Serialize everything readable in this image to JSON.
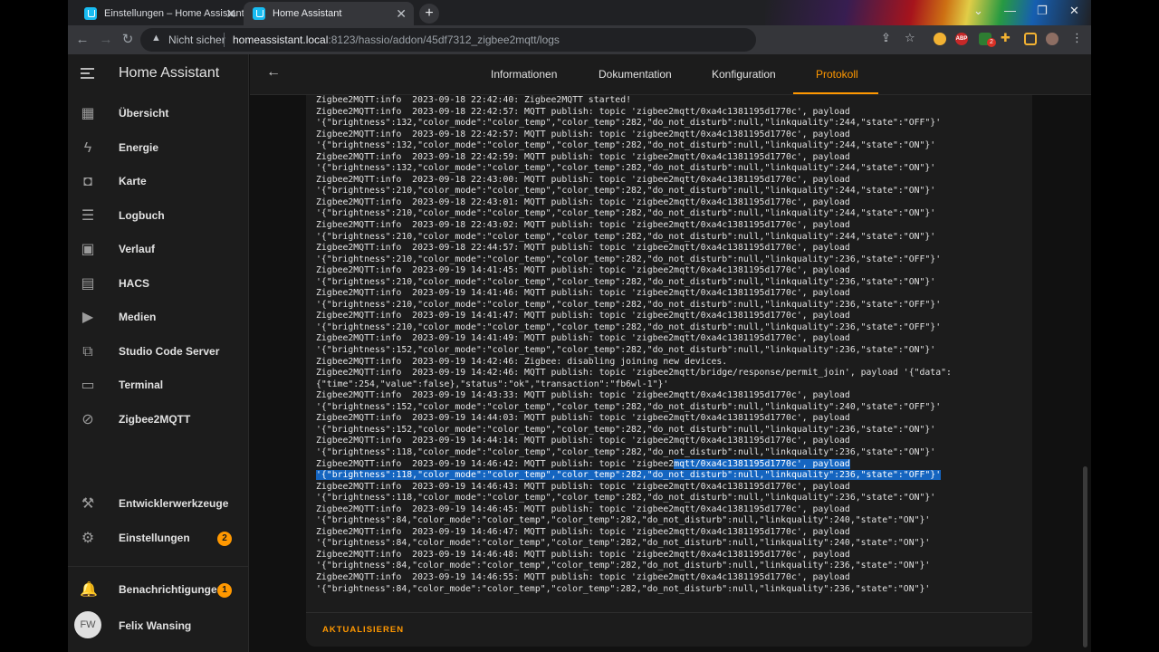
{
  "browser": {
    "tabs": [
      {
        "title": "Einstellungen – Home Assistant",
        "close": "✕"
      },
      {
        "title": "Home Assistant",
        "close": "✕"
      }
    ],
    "new_tab": "+",
    "window_controls": {
      "chevron": "⌄",
      "minimize": "—",
      "restore": "❐",
      "close": "✕"
    },
    "address": {
      "security_label": "Nicht sicher",
      "host": "homeassistant.local",
      "path": ":8123/hassio/addon/45df7312_zigbee2mqtt/logs"
    },
    "extension_badge": "2",
    "abp_label": "ABP"
  },
  "sidebar": {
    "title": "Home Assistant",
    "items": [
      {
        "label": "Übersicht",
        "icon": "▦"
      },
      {
        "label": "Energie",
        "icon": "ϟ"
      },
      {
        "label": "Karte",
        "icon": "◘"
      },
      {
        "label": "Logbuch",
        "icon": "☰"
      },
      {
        "label": "Verlauf",
        "icon": "▣"
      },
      {
        "label": "HACS",
        "icon": "▤"
      },
      {
        "label": "Medien",
        "icon": "▶"
      },
      {
        "label": "Studio Code Server",
        "icon": "⧉"
      },
      {
        "label": "Terminal",
        "icon": "▭"
      },
      {
        "label": "Zigbee2MQTT",
        "icon": "⊘"
      }
    ],
    "bottom_items": [
      {
        "label": "Entwicklerwerkzeuge",
        "icon": "⚒"
      },
      {
        "label": "Einstellungen",
        "icon": "⚙",
        "badge": "2"
      },
      {
        "label": "Benachrichtigungen",
        "icon": "🔔",
        "badge": "1"
      }
    ],
    "user": {
      "initials": "FW",
      "name": "Felix Wansing"
    }
  },
  "page": {
    "tabs": [
      "Informationen",
      "Dokumentation",
      "Konfiguration",
      "Protokoll"
    ],
    "active_tab": "Protokoll",
    "refresh_label": "AKTUALISIEREN"
  },
  "log_lines": [
    "Zigbee2MQTT:info  2023-09-18 22:42:40: Zigbee2MQTT started!",
    "Zigbee2MQTT:info  2023-09-18 22:42:57: MQTT publish: topic 'zigbee2mqtt/0xa4c1381195d1770c', payload",
    "'{\"brightness\":132,\"color_mode\":\"color_temp\",\"color_temp\":282,\"do_not_disturb\":null,\"linkquality\":244,\"state\":\"OFF\"}'",
    "Zigbee2MQTT:info  2023-09-18 22:42:57: MQTT publish: topic 'zigbee2mqtt/0xa4c1381195d1770c', payload",
    "'{\"brightness\":132,\"color_mode\":\"color_temp\",\"color_temp\":282,\"do_not_disturb\":null,\"linkquality\":244,\"state\":\"ON\"}'",
    "Zigbee2MQTT:info  2023-09-18 22:42:59: MQTT publish: topic 'zigbee2mqtt/0xa4c1381195d1770c', payload",
    "'{\"brightness\":132,\"color_mode\":\"color_temp\",\"color_temp\":282,\"do_not_disturb\":null,\"linkquality\":244,\"state\":\"ON\"}'",
    "Zigbee2MQTT:info  2023-09-18 22:43:00: MQTT publish: topic 'zigbee2mqtt/0xa4c1381195d1770c', payload",
    "'{\"brightness\":210,\"color_mode\":\"color_temp\",\"color_temp\":282,\"do_not_disturb\":null,\"linkquality\":244,\"state\":\"ON\"}'",
    "Zigbee2MQTT:info  2023-09-18 22:43:01: MQTT publish: topic 'zigbee2mqtt/0xa4c1381195d1770c', payload",
    "'{\"brightness\":210,\"color_mode\":\"color_temp\",\"color_temp\":282,\"do_not_disturb\":null,\"linkquality\":244,\"state\":\"ON\"}'",
    "Zigbee2MQTT:info  2023-09-18 22:43:02: MQTT publish: topic 'zigbee2mqtt/0xa4c1381195d1770c', payload",
    "'{\"brightness\":210,\"color_mode\":\"color_temp\",\"color_temp\":282,\"do_not_disturb\":null,\"linkquality\":244,\"state\":\"ON\"}'",
    "Zigbee2MQTT:info  2023-09-18 22:44:57: MQTT publish: topic 'zigbee2mqtt/0xa4c1381195d1770c', payload",
    "'{\"brightness\":210,\"color_mode\":\"color_temp\",\"color_temp\":282,\"do_not_disturb\":null,\"linkquality\":236,\"state\":\"OFF\"}'",
    "Zigbee2MQTT:info  2023-09-19 14:41:45: MQTT publish: topic 'zigbee2mqtt/0xa4c1381195d1770c', payload",
    "'{\"brightness\":210,\"color_mode\":\"color_temp\",\"color_temp\":282,\"do_not_disturb\":null,\"linkquality\":236,\"state\":\"ON\"}'",
    "Zigbee2MQTT:info  2023-09-19 14:41:46: MQTT publish: topic 'zigbee2mqtt/0xa4c1381195d1770c', payload",
    "'{\"brightness\":210,\"color_mode\":\"color_temp\",\"color_temp\":282,\"do_not_disturb\":null,\"linkquality\":236,\"state\":\"OFF\"}'",
    "Zigbee2MQTT:info  2023-09-19 14:41:47: MQTT publish: topic 'zigbee2mqtt/0xa4c1381195d1770c', payload",
    "'{\"brightness\":210,\"color_mode\":\"color_temp\",\"color_temp\":282,\"do_not_disturb\":null,\"linkquality\":236,\"state\":\"OFF\"}'",
    "Zigbee2MQTT:info  2023-09-19 14:41:49: MQTT publish: topic 'zigbee2mqtt/0xa4c1381195d1770c', payload",
    "'{\"brightness\":152,\"color_mode\":\"color_temp\",\"color_temp\":282,\"do_not_disturb\":null,\"linkquality\":236,\"state\":\"ON\"}'",
    "Zigbee2MQTT:info  2023-09-19 14:42:46: Zigbee: disabling joining new devices.",
    "Zigbee2MQTT:info  2023-09-19 14:42:46: MQTT publish: topic 'zigbee2mqtt/bridge/response/permit_join', payload '{\"data\":",
    "{\"time\":254,\"value\":false},\"status\":\"ok\",\"transaction\":\"fb6wl-1\"}'",
    "Zigbee2MQTT:info  2023-09-19 14:43:33: MQTT publish: topic 'zigbee2mqtt/0xa4c1381195d1770c', payload",
    "'{\"brightness\":152,\"color_mode\":\"color_temp\",\"color_temp\":282,\"do_not_disturb\":null,\"linkquality\":240,\"state\":\"OFF\"}'",
    "Zigbee2MQTT:info  2023-09-19 14:44:03: MQTT publish: topic 'zigbee2mqtt/0xa4c1381195d1770c', payload",
    "'{\"brightness\":152,\"color_mode\":\"color_temp\",\"color_temp\":282,\"do_not_disturb\":null,\"linkquality\":236,\"state\":\"ON\"}'",
    "Zigbee2MQTT:info  2023-09-19 14:44:14: MQTT publish: topic 'zigbee2mqtt/0xa4c1381195d1770c', payload",
    "'{\"brightness\":118,\"color_mode\":\"color_temp\",\"color_temp\":282,\"do_not_disturb\":null,\"linkquality\":236,\"state\":\"ON\"}'",
    "Zigbee2MQTT:info  2023-09-19 14:46:42: MQTT publish: topic 'zigbee2mqtt/0xa4c1381195d1770c', payload",
    "'{\"brightness\":118,\"color_mode\":\"color_temp\",\"color_temp\":282,\"do_not_disturb\":null,\"linkquality\":236,\"state\":\"OFF\"}'",
    "Zigbee2MQTT:info  2023-09-19 14:46:43: MQTT publish: topic 'zigbee2mqtt/0xa4c1381195d1770c', payload",
    "'{\"brightness\":118,\"color_mode\":\"color_temp\",\"color_temp\":282,\"do_not_disturb\":null,\"linkquality\":236,\"state\":\"ON\"}'",
    "Zigbee2MQTT:info  2023-09-19 14:46:45: MQTT publish: topic 'zigbee2mqtt/0xa4c1381195d1770c', payload",
    "'{\"brightness\":84,\"color_mode\":\"color_temp\",\"color_temp\":282,\"do_not_disturb\":null,\"linkquality\":240,\"state\":\"ON\"}'",
    "Zigbee2MQTT:info  2023-09-19 14:46:47: MQTT publish: topic 'zigbee2mqtt/0xa4c1381195d1770c', payload",
    "'{\"brightness\":84,\"color_mode\":\"color_temp\",\"color_temp\":282,\"do_not_disturb\":null,\"linkquality\":240,\"state\":\"ON\"}'",
    "Zigbee2MQTT:info  2023-09-19 14:46:48: MQTT publish: topic 'zigbee2mqtt/0xa4c1381195d1770c', payload",
    "'{\"brightness\":84,\"color_mode\":\"color_temp\",\"color_temp\":282,\"do_not_disturb\":null,\"linkquality\":236,\"state\":\"ON\"}'",
    "Zigbee2MQTT:info  2023-09-19 14:46:55: MQTT publish: topic 'zigbee2mqtt/0xa4c1381195d1770c', payload",
    "'{\"brightness\":84,\"color_mode\":\"color_temp\",\"color_temp\":282,\"do_not_disturb\":null,\"linkquality\":236,\"state\":\"ON\"}'"
  ],
  "colors": {
    "accent": "#ff9800",
    "selection": "#1565c0",
    "sidebar_bg": "#1c1c1c",
    "main_bg": "#111111"
  }
}
